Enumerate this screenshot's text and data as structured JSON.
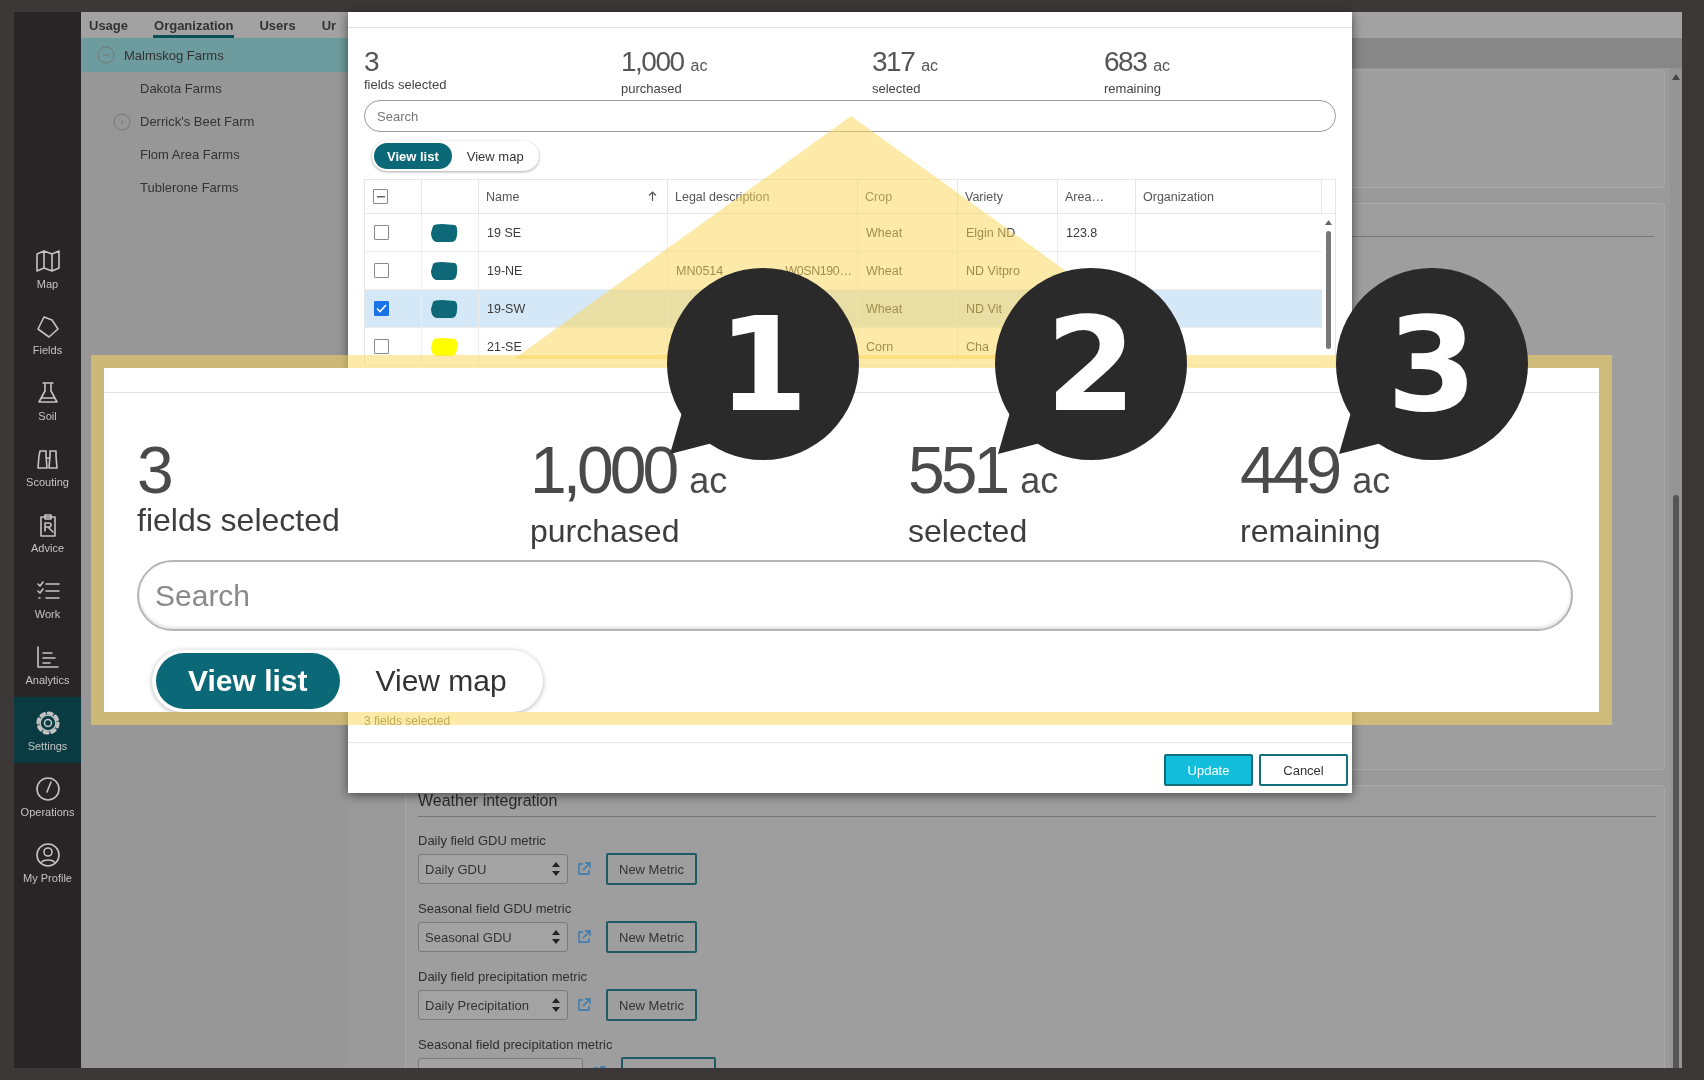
{
  "sidebar": {
    "items": [
      {
        "label": "Map",
        "selected": false
      },
      {
        "label": "Fields",
        "selected": false
      },
      {
        "label": "Soil",
        "selected": false
      },
      {
        "label": "Scouting",
        "selected": false
      },
      {
        "label": "Advice",
        "selected": false
      },
      {
        "label": "Work",
        "selected": false
      },
      {
        "label": "Analytics",
        "selected": false
      },
      {
        "label": "Settings",
        "selected": true
      },
      {
        "label": "Operations",
        "selected": false
      },
      {
        "label": "My Profile",
        "selected": false
      }
    ]
  },
  "tabs": [
    {
      "label": "Usage",
      "selected": false
    },
    {
      "label": "Organization",
      "selected": true
    },
    {
      "label": "Users",
      "selected": false
    },
    {
      "label": "Ur",
      "selected": false
    }
  ],
  "tree": [
    {
      "label": "Malmskog Farms",
      "selected": true,
      "expanded": true,
      "children": [
        {
          "label": "Dakota Farms",
          "selected": false
        },
        {
          "label": "Derrick's Beet Farm",
          "selected": false,
          "expanded": false
        },
        {
          "label": "Flom Area Farms",
          "selected": false
        },
        {
          "label": "Tublerone Farms",
          "selected": false
        }
      ]
    }
  ],
  "weather_integration": {
    "title": "Weather integration",
    "metrics": [
      {
        "label": "Daily field GDU metric",
        "value": "Daily GDU",
        "button": "New Metric"
      },
      {
        "label": "Seasonal field GDU metric",
        "value": "Seasonal GDU",
        "button": "New Metric"
      },
      {
        "label": "Daily field precipitation metric",
        "value": "Daily Precipitation",
        "button": "New Metric"
      },
      {
        "label": "Seasonal field precipitation metric"
      }
    ]
  },
  "dialog": {
    "stats": [
      {
        "value": "3",
        "label": "fields selected"
      },
      {
        "value": "1,000",
        "unit": "ac",
        "label": "purchased"
      },
      {
        "value": "317",
        "unit": "ac",
        "label": "selected"
      },
      {
        "value": "683",
        "unit": "ac",
        "label": "remaining"
      }
    ],
    "search": {
      "placeholder": "Search"
    },
    "view_toggle": [
      {
        "label": "View list",
        "selected": true
      },
      {
        "label": "View map",
        "selected": false
      }
    ],
    "table": {
      "select_all_indeterminate": true,
      "columns": [
        {
          "label": "Name",
          "sorted": true
        },
        {
          "label": "Legal description",
          "sorted": false
        },
        {
          "label": "Crop",
          "sorted": false
        },
        {
          "label": "Variety",
          "sorted": false
        },
        {
          "label": "Area…",
          "sorted": false
        },
        {
          "label": "Organization",
          "sorted": false
        }
      ],
      "rows": [
        {
          "checked": false,
          "selected": false,
          "color": "#0e6877",
          "name": "19 SE",
          "crop": "Wheat",
          "variety": "Elgin ND",
          "area": "123.8"
        },
        {
          "checked": false,
          "selected": false,
          "color": "#0e6877",
          "name": "19-NE",
          "legal_description": [
            "MN0514",
            "W0SN190…"
          ],
          "crop": "Wheat",
          "variety": "ND Vitpro"
        },
        {
          "checked": true,
          "selected": true,
          "color": "#0e6877",
          "name": "19-SW",
          "crop": "Wheat",
          "variety": "ND Vit"
        },
        {
          "checked": false,
          "selected": false,
          "color": "#ffff00",
          "name": "21-SE",
          "crop": "Corn",
          "variety": "Cha"
        }
      ]
    },
    "selection_summary": "3 fields selected",
    "buttons": [
      {
        "label": "Update",
        "kind": "primary"
      },
      {
        "label": "Cancel",
        "kind": "secondary"
      }
    ]
  },
  "callout": {
    "stats": [
      {
        "value": "3",
        "label": "fields selected"
      },
      {
        "value": "1,000",
        "unit": "ac",
        "label": "purchased"
      },
      {
        "value": "551",
        "unit": "ac",
        "label": "selected"
      },
      {
        "value": "449",
        "unit": "ac",
        "label": "remaining"
      }
    ],
    "search": {
      "placeholder": "Search"
    },
    "view_toggle": [
      {
        "label": "View list",
        "selected": true
      },
      {
        "label": "View map",
        "selected": false
      }
    ]
  },
  "badges": [
    "1",
    "2",
    "3"
  ]
}
